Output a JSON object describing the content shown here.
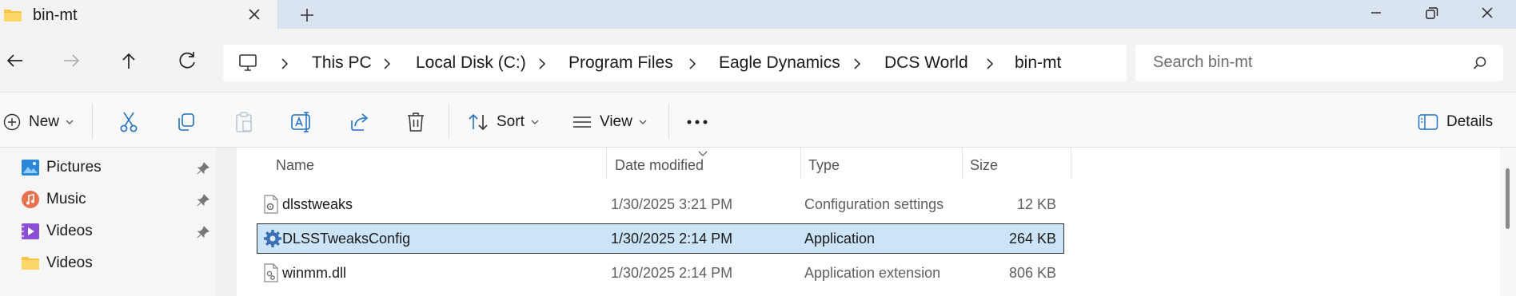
{
  "window": {
    "tab_title": "bin-mt"
  },
  "address_bar": {
    "breadcrumbs": [
      "This PC",
      "Local Disk (C:)",
      "Program Files",
      "Eagle Dynamics",
      "DCS World",
      "bin-mt"
    ]
  },
  "search": {
    "placeholder": "Search bin-mt"
  },
  "toolbar": {
    "new_label": "New",
    "sort_label": "Sort",
    "view_label": "View",
    "details_label": "Details"
  },
  "sidebar": {
    "items": [
      {
        "label": "Pictures",
        "icon": "pictures-icon",
        "pinned": true
      },
      {
        "label": "Music",
        "icon": "music-icon",
        "pinned": true
      },
      {
        "label": "Videos",
        "icon": "videos-icon",
        "pinned": true
      },
      {
        "label": "Videos",
        "icon": "folder-icon",
        "pinned": false
      }
    ]
  },
  "file_list": {
    "columns": [
      "Name",
      "Date modified",
      "Type",
      "Size"
    ],
    "sort_column": "Date modified",
    "rows": [
      {
        "name": "dlsstweaks",
        "date": "1/30/2025 3:21 PM",
        "type": "Configuration settings",
        "size": "12 KB",
        "icon": "config-file-icon",
        "selected": false
      },
      {
        "name": "DLSSTweaksConfig",
        "date": "1/30/2025 2:14 PM",
        "type": "Application",
        "size": "264 KB",
        "icon": "application-gear-icon",
        "selected": true
      },
      {
        "name": "winmm.dll",
        "date": "1/30/2025 2:14 PM",
        "type": "Application extension",
        "size": "806 KB",
        "icon": "dll-file-icon",
        "selected": false
      }
    ]
  },
  "colors": {
    "titlebar": "#d9e4f0",
    "selection": "#cce4f7",
    "accent": "#0067c0"
  }
}
